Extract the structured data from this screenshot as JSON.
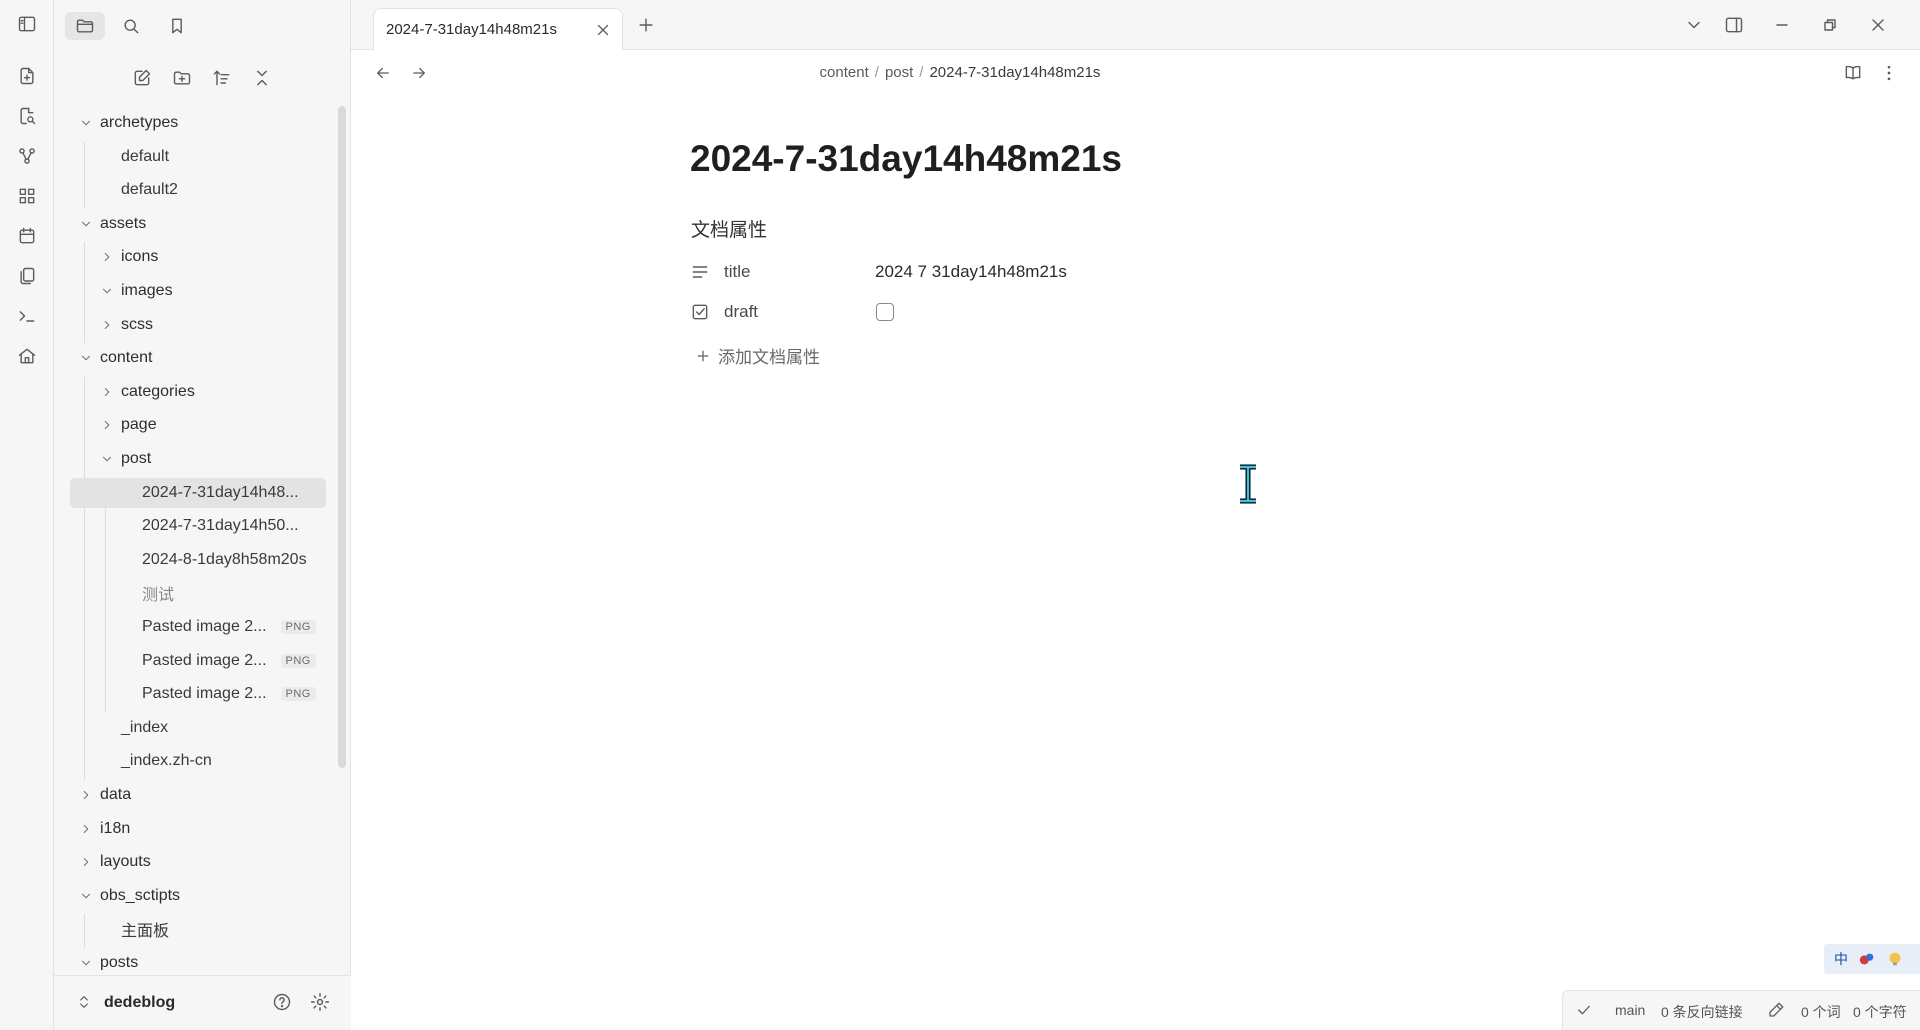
{
  "sidebar": {
    "tree": [
      {
        "label": "archetypes",
        "type": "folder",
        "open": true
      },
      {
        "label": "default",
        "type": "file"
      },
      {
        "label": "default2",
        "type": "file"
      },
      {
        "label": "assets",
        "type": "folder",
        "open": true
      },
      {
        "label": "icons",
        "type": "folder",
        "open": false
      },
      {
        "label": "images",
        "type": "folder",
        "open": true
      },
      {
        "label": "scss",
        "type": "folder",
        "open": false
      },
      {
        "label": "content",
        "type": "folder",
        "open": true
      },
      {
        "label": "categories",
        "type": "folder",
        "open": false
      },
      {
        "label": "page",
        "type": "folder",
        "open": false
      },
      {
        "label": "post",
        "type": "folder",
        "open": true
      },
      {
        "label": "2024-7-31day14h48...",
        "type": "file",
        "selected": true
      },
      {
        "label": "2024-7-31day14h50...",
        "type": "file"
      },
      {
        "label": "2024-8-1day8h58m20s",
        "type": "file"
      },
      {
        "label": "测试",
        "type": "file",
        "muted": true
      },
      {
        "label": "Pasted image 2...",
        "type": "file",
        "badge": "PNG"
      },
      {
        "label": "Pasted image 2...",
        "type": "file",
        "badge": "PNG"
      },
      {
        "label": "Pasted image 2...",
        "type": "file",
        "badge": "PNG"
      },
      {
        "label": "_index",
        "type": "file"
      },
      {
        "label": "_index.zh-cn",
        "type": "file"
      },
      {
        "label": "data",
        "type": "folder",
        "open": false
      },
      {
        "label": "i18n",
        "type": "folder",
        "open": false
      },
      {
        "label": "layouts",
        "type": "folder",
        "open": false
      },
      {
        "label": "obs_sctipts",
        "type": "folder",
        "open": true
      },
      {
        "label": "主面板",
        "type": "file"
      },
      {
        "label": "posts",
        "type": "folder",
        "open": true
      }
    ],
    "vault_name": "dedeblog"
  },
  "tab": {
    "title": "2024-7-31day14h48m21s"
  },
  "breadcrumb": {
    "part1": "content",
    "sep": "/",
    "part2": "post",
    "current": "2024-7-31day14h48m21s"
  },
  "document": {
    "title": "2024-7-31day14h48m21s",
    "properties_heading": "文档属性",
    "properties": {
      "title_key": "title",
      "title_value": "2024 7 31day14h48m21s",
      "draft_key": "draft",
      "draft_checked": false
    },
    "add_property": "添加文档属性"
  },
  "ime": {
    "mode": "中"
  },
  "statusbar": {
    "branch": "main",
    "backlinks": "0 条反向链接",
    "words": "0 个词",
    "chars": "0 个字符"
  }
}
